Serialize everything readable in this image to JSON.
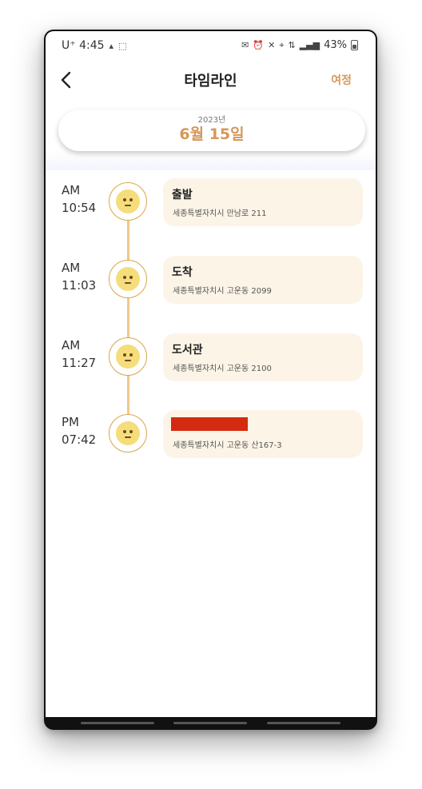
{
  "status_bar": {
    "carrier_time": "U⁺ 4:45",
    "battery": "43%",
    "icons": [
      "mail-icon",
      "alarm-icon",
      "mute-icon",
      "location-icon",
      "lte-icon",
      "signal-icon"
    ]
  },
  "header": {
    "title": "타임라인",
    "journey_label": "여정"
  },
  "date": {
    "year": "2023년",
    "day": "6월 15일"
  },
  "timeline": [
    {
      "period": "AM",
      "time": "10:54",
      "title": "출발",
      "address": "세종특별자치시 만남로 211"
    },
    {
      "period": "AM",
      "time": "11:03",
      "title": "도착",
      "address": "세종특별자치시 고운동 2099"
    },
    {
      "period": "AM",
      "time": "11:27",
      "title": "도서관",
      "address": "세종특별자치시 고운동 2100"
    },
    {
      "period": "PM",
      "time": "07:42",
      "title": "",
      "address": "세종특별자치시 고운동 산167-3",
      "redacted": true
    }
  ],
  "colors": {
    "accent": "#d5975a",
    "card_bg": "#fcf4e7",
    "line": "#f0c98e",
    "redaction": "#d42a10"
  }
}
